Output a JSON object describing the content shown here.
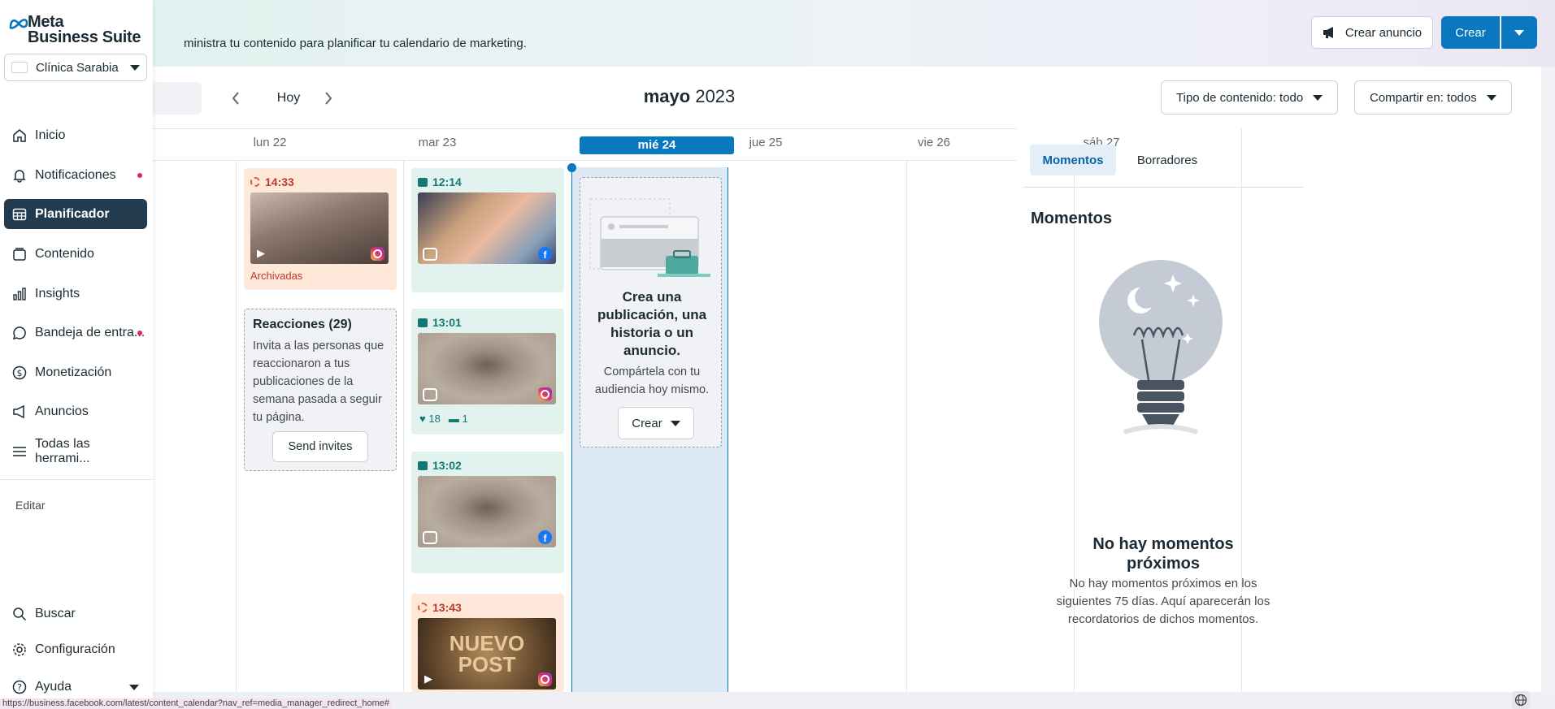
{
  "app": {
    "logo_text_line1": "Meta",
    "logo_text_line2": "Business Suite",
    "subtitle": "ministra tu contenido para planificar tu calendario de marketing."
  },
  "header": {
    "create_ad_label": "Crear anuncio",
    "create_label": "Crear"
  },
  "sidebar": {
    "account_name": "Clínica Sarabia Me...",
    "items": [
      {
        "label": "Inicio",
        "icon": "home-icon"
      },
      {
        "label": "Notificaciones",
        "icon": "bell-icon"
      },
      {
        "label": "Planificador",
        "icon": "calendar-icon"
      },
      {
        "label": "Contenido",
        "icon": "content-icon"
      },
      {
        "label": "Insights",
        "icon": "insights-icon"
      },
      {
        "label": "Bandeja de entra...",
        "icon": "inbox-icon"
      },
      {
        "label": "Monetización",
        "icon": "dollar-icon"
      },
      {
        "label": "Anuncios",
        "icon": "megaphone-icon"
      },
      {
        "label": "Todas las herrami...",
        "icon": "menu-icon"
      }
    ],
    "edit_label": "Editar",
    "bottom_items": [
      {
        "label": "Buscar",
        "icon": "search-icon"
      },
      {
        "label": "Configuración",
        "icon": "gear-icon"
      },
      {
        "label": "Ayuda",
        "icon": "help-icon"
      }
    ]
  },
  "calendar": {
    "today_label": "Hoy",
    "month": "mayo",
    "year": "2023",
    "filter_content": "Tipo de contenido: todo",
    "filter_share": "Compartir en: todos",
    "days": [
      "lun 22",
      "mar 23",
      "mié 24",
      "jue 25",
      "vie 26",
      "sáb 27"
    ],
    "posts": {
      "lun_post": {
        "time": "14:33",
        "status": "Archivadas"
      },
      "mar_post1": {
        "time": "12:14"
      },
      "mar_post2": {
        "time": "13:01",
        "likes": "18",
        "comments": "1"
      },
      "mar_post3": {
        "time": "13:02"
      },
      "mar_post4": {
        "time": "13:43",
        "thumb_text": "NUEVO POST"
      }
    },
    "reactions_card": {
      "title": "Reacciones (29)",
      "body": "Invita a las personas que reaccionaron a tus publicaciones de la semana pasada a seguir tu página.",
      "button": "Send invites"
    },
    "create_card": {
      "title": "Crea una publicación, una historia o un anuncio.",
      "body": "Compártela con tu audiencia hoy mismo.",
      "button": "Crear"
    }
  },
  "right_panel": {
    "tab_moments": "Momentos",
    "tab_drafts": "Borradores",
    "heading": "Momentos",
    "empty_title": "No hay momentos próximos",
    "empty_body": "No hay momentos próximos en los siguientes 75 días. Aquí aparecerán los recordatorios de dichos momentos."
  },
  "status_bar": {
    "url": "https://business.facebook.com/latest/content_calendar?nav_ref=media_manager_redirect_home#"
  },
  "colors": {
    "primary": "#0a78be",
    "sidebar_active": "#223b4e",
    "peach_card": "#fde8da",
    "mint_card": "#e2f2ee",
    "today_column": "#dde9f5"
  }
}
